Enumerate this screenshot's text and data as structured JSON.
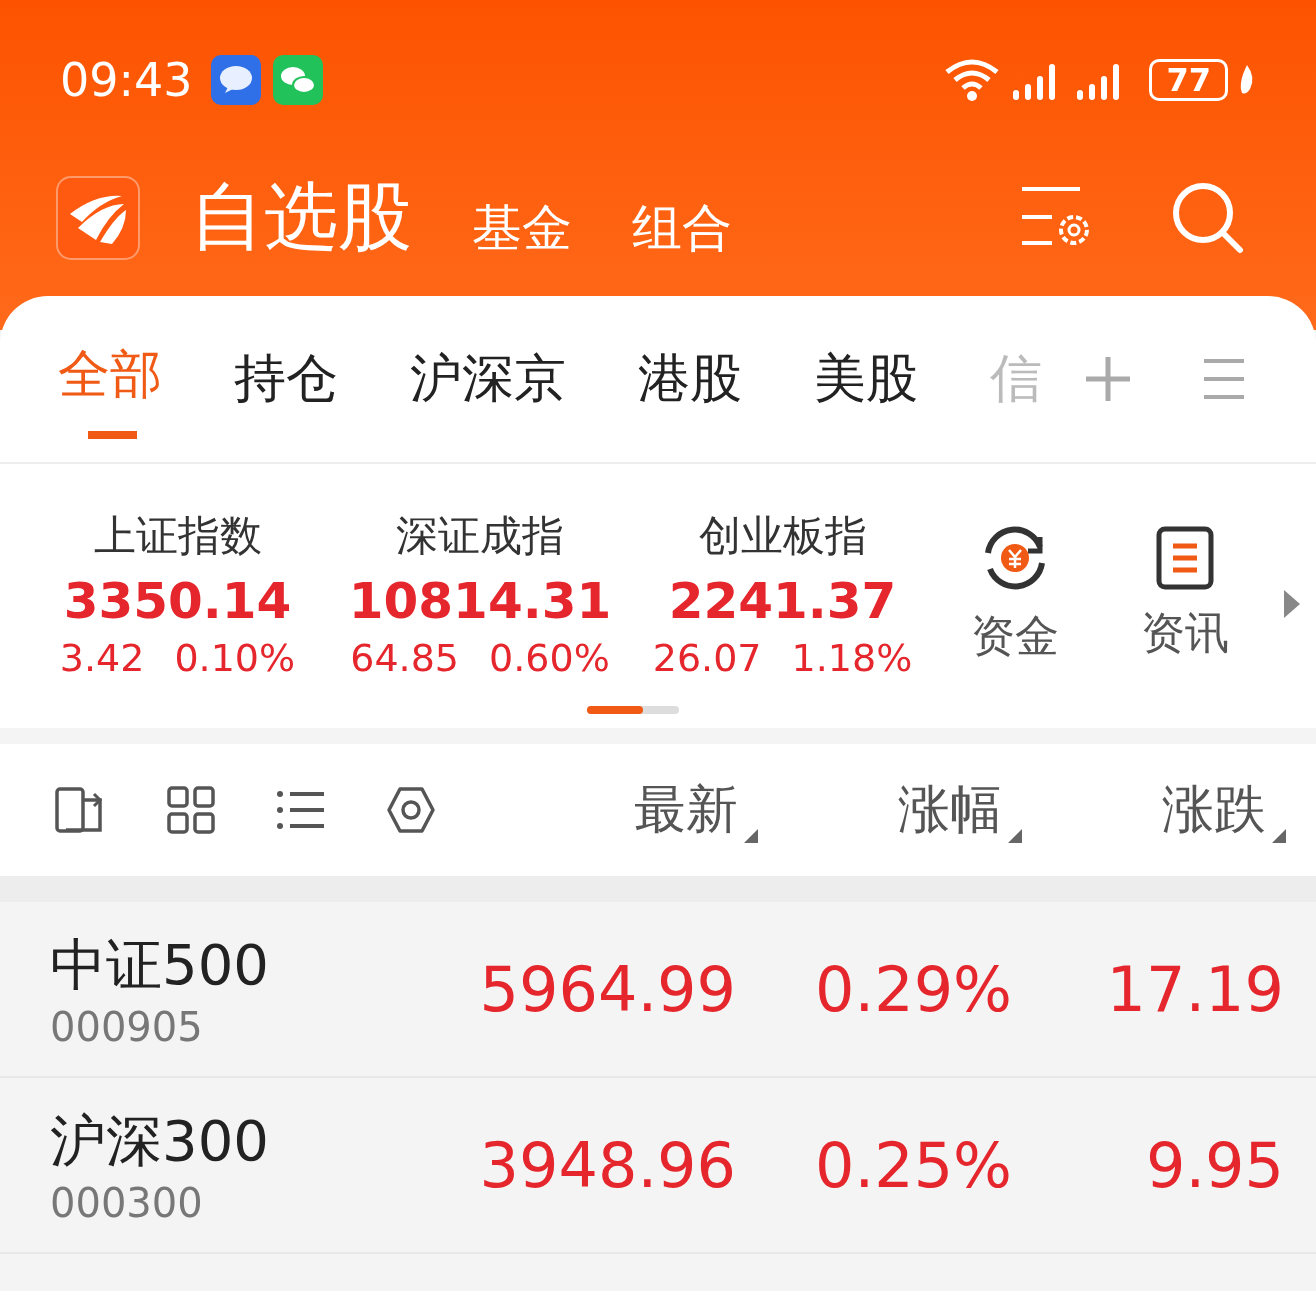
{
  "status_bar": {
    "time": "09:43",
    "battery": "77"
  },
  "header": {
    "title": "自选股",
    "links": [
      "基金",
      "组合"
    ]
  },
  "tabs": [
    {
      "label": "全部",
      "selected": true
    },
    {
      "label": "持仓",
      "selected": false
    },
    {
      "label": "沪深京",
      "selected": false
    },
    {
      "label": "港股",
      "selected": false
    },
    {
      "label": "美股",
      "selected": false
    },
    {
      "label": "信",
      "selected": false
    }
  ],
  "indices": [
    {
      "name": "上证指数",
      "value": "3350.14",
      "change": "3.42",
      "percent": "0.10%"
    },
    {
      "name": "深证成指",
      "value": "10814.31",
      "change": "64.85",
      "percent": "0.60%"
    },
    {
      "name": "创业板指",
      "value": "2241.37",
      "change": "26.07",
      "percent": "1.18%"
    }
  ],
  "shortcuts": [
    {
      "label": "资金",
      "kind": "funds"
    },
    {
      "label": "资讯",
      "kind": "news"
    }
  ],
  "columns": [
    "最新",
    "涨幅",
    "涨跌"
  ],
  "rows": [
    {
      "name": "中证500",
      "code": "000905",
      "latest": "5964.99",
      "pct": "0.29%",
      "change": "17.19"
    },
    {
      "name": "沪深300",
      "code": "000300",
      "latest": "3948.96",
      "pct": "0.25%",
      "change": "9.95"
    }
  ]
}
